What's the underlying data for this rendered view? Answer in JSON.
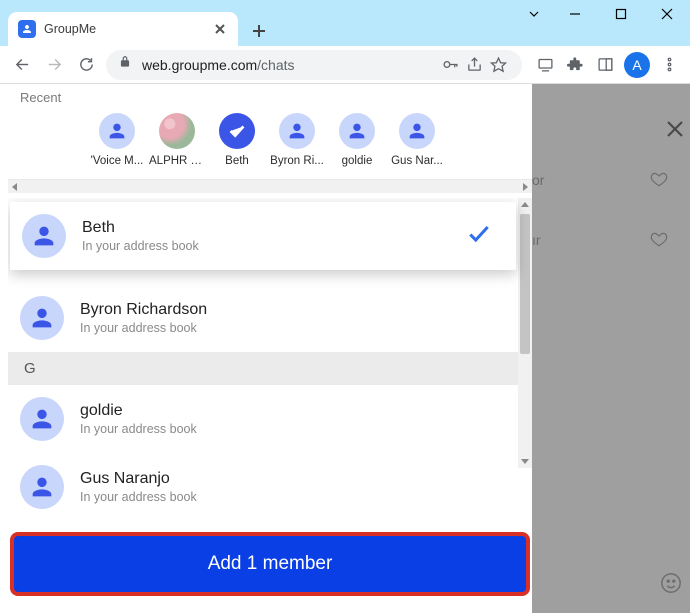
{
  "window": {
    "tab_title": "GroupMe",
    "url_host": "web.groupme.com",
    "url_path": "/chats"
  },
  "profile": {
    "letter": "A"
  },
  "modal": {
    "recent_label": "Recent",
    "recent": [
      {
        "label": "'Voice M..."
      },
      {
        "label": "ALPHR J...",
        "photo": true
      },
      {
        "label": "Beth",
        "selected": true
      },
      {
        "label": "Byron Ri..."
      },
      {
        "label": "goldie"
      },
      {
        "label": "Gus Nar..."
      }
    ],
    "address_book_sub": "In your address book",
    "section_letter_g": "G",
    "list": [
      {
        "name": "Beth",
        "selected": true
      },
      {
        "name": "Byron Richardson"
      },
      {
        "name": "goldie"
      },
      {
        "name": "Gus Naranjo"
      }
    ],
    "add_button": "Add 1 member"
  },
  "backdrop": {
    "cut1": "or",
    "cut2": "ır"
  }
}
